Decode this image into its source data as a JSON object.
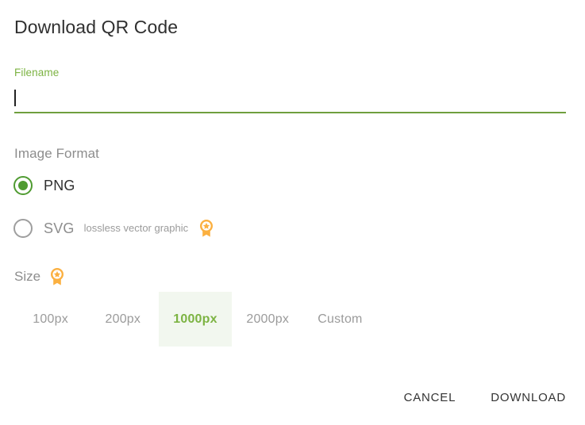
{
  "dialog": {
    "title": "Download QR Code"
  },
  "filename_field": {
    "label": "Filename",
    "value": "",
    "placeholder": "",
    "focused": true,
    "underline_color": "#6f9f3e",
    "label_color": "#7cb342"
  },
  "image_format": {
    "heading": "Image Format",
    "selected": "PNG",
    "options": [
      {
        "label": "PNG",
        "checked": true,
        "hint": "",
        "premium": false
      },
      {
        "label": "SVG",
        "checked": false,
        "hint": "lossless vector graphic",
        "premium": true
      }
    ]
  },
  "size": {
    "heading": "Size",
    "premium": true,
    "selected": "1000px",
    "options": [
      {
        "label": "100px",
        "selected": false
      },
      {
        "label": "200px",
        "selected": false
      },
      {
        "label": "1000px",
        "selected": true
      },
      {
        "label": "2000px",
        "selected": false
      },
      {
        "label": "Custom",
        "selected": false
      }
    ]
  },
  "actions": {
    "cancel_label": "CANCEL",
    "download_label": "DOWNLOAD"
  },
  "icons": {
    "premium_badge": "award-badge-icon"
  },
  "colors": {
    "accent_green": "#7cb342",
    "underline_green": "#6f9f3e",
    "radio_green": "#4f9b31",
    "selected_cell_bg": "#f2f7ef",
    "premium_orange": "#fbb040",
    "text_dark": "#303030",
    "text_muted": "#8d8d8d",
    "text_hint": "#9b9b9b"
  }
}
